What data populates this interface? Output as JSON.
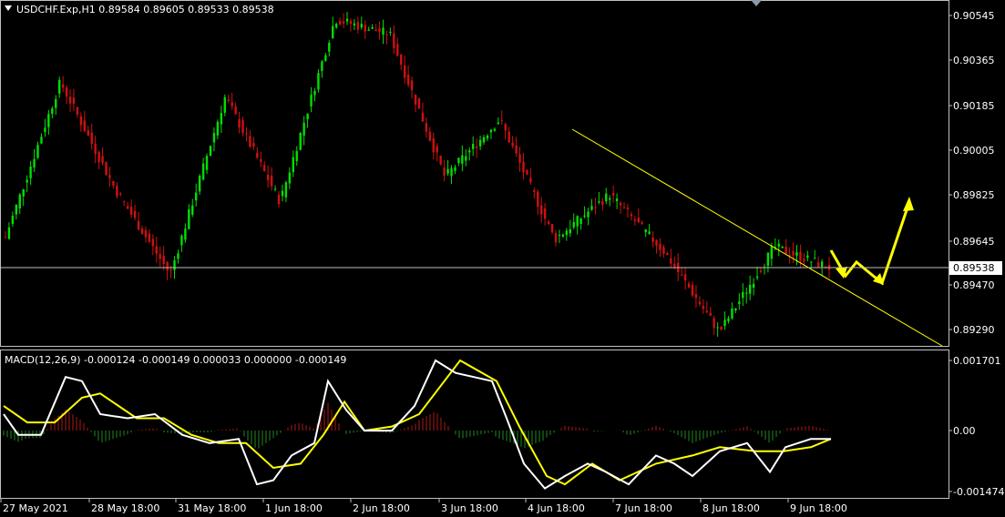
{
  "header": {
    "title": "USDCHF.Exp,H1  0.89584 0.89605 0.89533 0.89538"
  },
  "price_axis": {
    "ticks": [
      "0.90545",
      "0.90365",
      "0.90185",
      "0.90005",
      "0.89825",
      "0.89645",
      "0.89470",
      "0.89290"
    ],
    "current_price": "0.89538"
  },
  "macd": {
    "label": "MACD(12,26,9) -0.000124 -0.000149 0.000033 0.000000 -0.000149",
    "ticks": [
      "0.001701",
      "0.00",
      "-0.001474"
    ]
  },
  "time_axis": {
    "labels": [
      "27 May 2021",
      "28 May 18:00",
      "31 May 18:00",
      "1 Jun 18:00",
      "2 Jun 18:00",
      "3 Jun 18:00",
      "4 Jun 18:00",
      "7 Jun 18:00",
      "8 Jun 18:00",
      "9 Jun 18:00"
    ]
  },
  "colors": {
    "bull": "#00e000",
    "bear": "#d01010",
    "trendline": "#ffff00",
    "macd_line": "#ffffff",
    "signal_line": "#ffff00",
    "hist_pos": "#b01818",
    "hist_neg": "#1f8a1f",
    "grid": "#c0c0c0"
  },
  "chart_data": {
    "type": "candlestick",
    "symbol": "USDCHF.Exp",
    "timeframe": "H1",
    "ohlc_last": {
      "open": 0.89584,
      "high": 0.89605,
      "low": 0.89533,
      "close": 0.89538
    },
    "price_range": [
      0.892,
      0.9062
    ],
    "key_points": [
      {
        "time": "27 May 2021",
        "price": 0.8966
      },
      {
        "time": "28 May",
        "price": 0.9028
      },
      {
        "time": "31 May",
        "price": 0.8985
      },
      {
        "time": "1 Jun",
        "price": 0.8951
      },
      {
        "time": "1 Jun late",
        "price": 0.9022
      },
      {
        "time": "2 Jun",
        "price": 0.898
      },
      {
        "time": "3 Jun",
        "price": 0.9053
      },
      {
        "time": "3 Jun late",
        "price": 0.9047
      },
      {
        "time": "4 Jun",
        "price": 0.899
      },
      {
        "time": "4 Jun late",
        "price": 0.9013
      },
      {
        "time": "7 Jun",
        "price": 0.8965
      },
      {
        "time": "7 Jun late",
        "price": 0.8983
      },
      {
        "time": "8 Jun",
        "price": 0.896
      },
      {
        "time": "8 Jun late",
        "price": 0.8928
      },
      {
        "time": "9 Jun",
        "price": 0.8962
      },
      {
        "time": "9 Jun late",
        "price": 0.89538
      }
    ],
    "macd": {
      "fast": 12,
      "slow": 26,
      "signal": 9,
      "values": [
        -0.000124,
        -0.000149,
        3.3e-05,
        0.0,
        -0.000149
      ],
      "range": [
        -0.001474,
        0.001701
      ]
    }
  }
}
